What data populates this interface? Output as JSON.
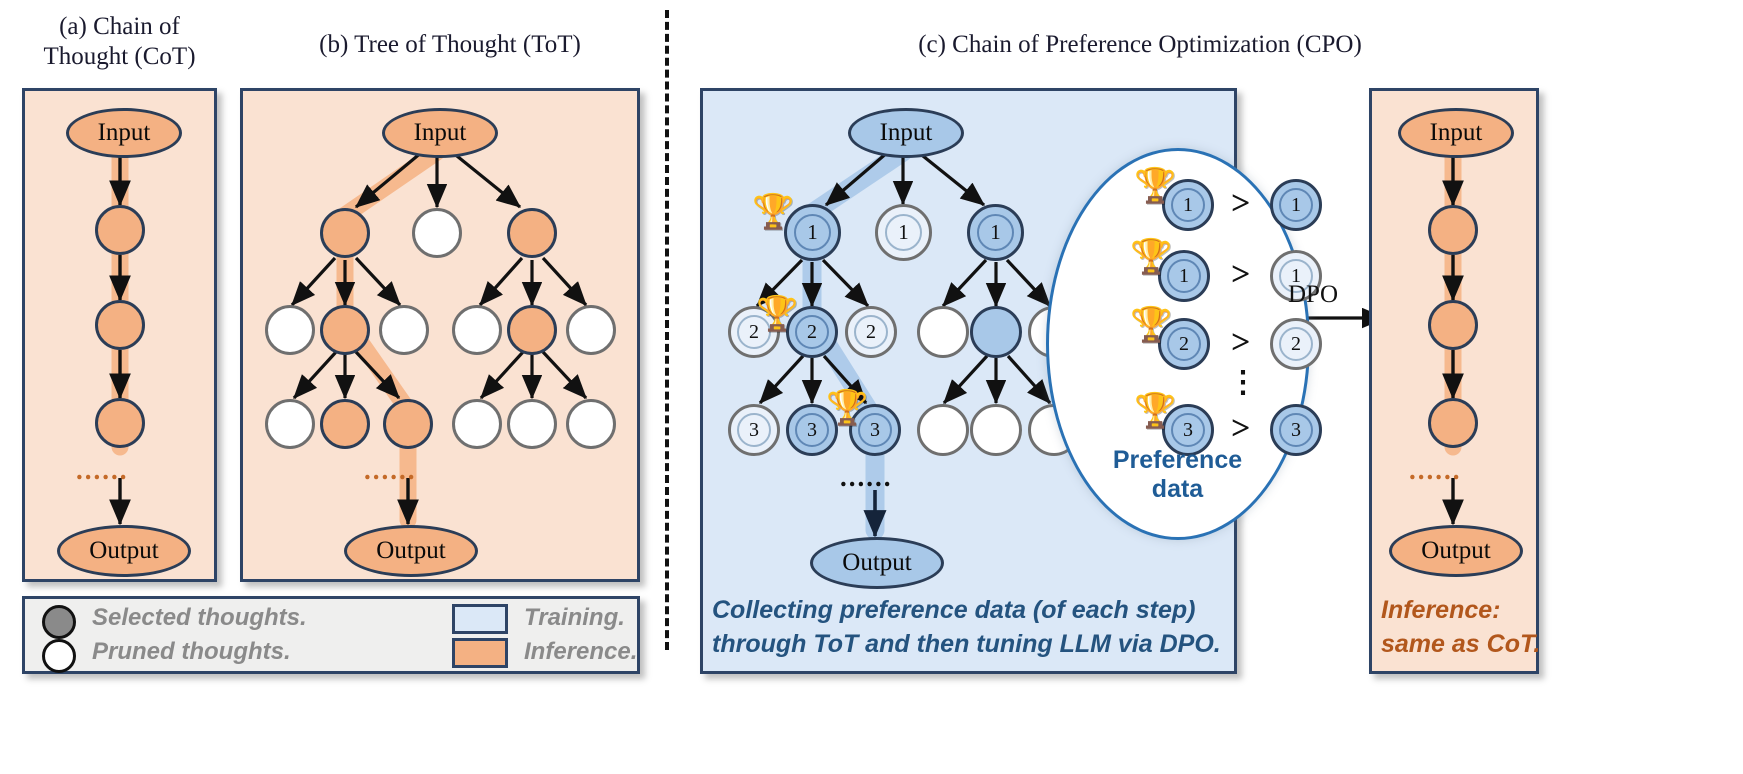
{
  "figure": {
    "domain": "diagram",
    "panels": [
      {
        "id": "a",
        "title_line1": "(a) Chain of",
        "title_line2": "Thought (CoT)"
      },
      {
        "id": "b",
        "title_line1": "(b) Tree of Thought (ToT)",
        "title_line2": ""
      },
      {
        "id": "c",
        "title_line1": "(c) Chain of Preference Optimization (CPO)",
        "title_line2": ""
      }
    ]
  },
  "labels": {
    "input": "Input",
    "output": "Output",
    "dots": "......",
    "dpo": "DPO",
    "gt": ">",
    "vdots": "⋮",
    "trophy": "🏆"
  },
  "preference": {
    "label_line1": "Preference",
    "label_line2": "data",
    "rows": [
      {
        "left_num": "1",
        "left_style": "selected",
        "right_num": "1",
        "right_style": "selected"
      },
      {
        "left_num": "1",
        "left_style": "selected",
        "right_num": "1",
        "right_style": "pruned"
      },
      {
        "left_num": "2",
        "left_style": "selected",
        "right_num": "2",
        "right_style": "pruned"
      },
      {
        "left_num": "3",
        "left_style": "selected",
        "right_num": "3",
        "right_style": "selected"
      }
    ]
  },
  "tree_tot": {
    "level1": [
      "selected",
      "pruned",
      "selected"
    ],
    "level2": [
      "pruned",
      "selected",
      "pruned",
      "pruned",
      "selected",
      "pruned"
    ],
    "level3": [
      "pruned",
      "selected",
      "selected",
      "pruned",
      "pruned",
      "pruned"
    ]
  },
  "tree_cpo": {
    "level1": [
      {
        "num": "1",
        "style": "selected",
        "trophy": true
      },
      {
        "num": "1",
        "style": "pruned",
        "trophy": false
      },
      {
        "num": "1",
        "style": "selected",
        "trophy": false
      }
    ],
    "level2": [
      {
        "num": "2",
        "style": "pruned",
        "trophy": false
      },
      {
        "num": "2",
        "style": "selected",
        "trophy": true
      },
      {
        "num": "2",
        "style": "pruned",
        "trophy": false
      },
      {
        "num": "",
        "style": "pruned",
        "trophy": false
      },
      {
        "num": "",
        "style": "selected",
        "trophy": false
      },
      {
        "num": "",
        "style": "pruned",
        "trophy": false
      }
    ],
    "level3": [
      {
        "num": "3",
        "style": "pruned",
        "trophy": false
      },
      {
        "num": "3",
        "style": "selected",
        "trophy": false
      },
      {
        "num": "3",
        "style": "selected",
        "trophy": true
      },
      {
        "num": "",
        "style": "pruned",
        "trophy": false
      },
      {
        "num": "",
        "style": "pruned",
        "trophy": false
      },
      {
        "num": "",
        "style": "pruned",
        "trophy": false
      }
    ]
  },
  "legend": {
    "items": [
      {
        "kind": "circle-filled",
        "text": "Selected thoughts."
      },
      {
        "kind": "circle-empty",
        "text": "Pruned thoughts."
      },
      {
        "kind": "swatch-blue",
        "text": "Training."
      },
      {
        "kind": "swatch-orange",
        "text": "Inference."
      }
    ]
  },
  "captions": {
    "cpo_line1": "Collecting preference data (of each step)",
    "cpo_line2": "through ToT and then tuning LLM via DPO.",
    "infer_line1": "Inference:",
    "infer_line2": "same as CoT."
  },
  "colors": {
    "inference_fill": "#fae2d2",
    "training_fill": "#dbe8f7",
    "selected_orange": "#f4b183",
    "selected_blue": "#a8c8e8",
    "panel_border": "#2e4466",
    "ellipse_border": "#2a72b5",
    "legend_bg": "#efefee",
    "legend_text": "#8a8a8a",
    "caption_blue": "#24537f",
    "caption_orange": "#b2571c",
    "pref_label": "#1f5c96"
  }
}
